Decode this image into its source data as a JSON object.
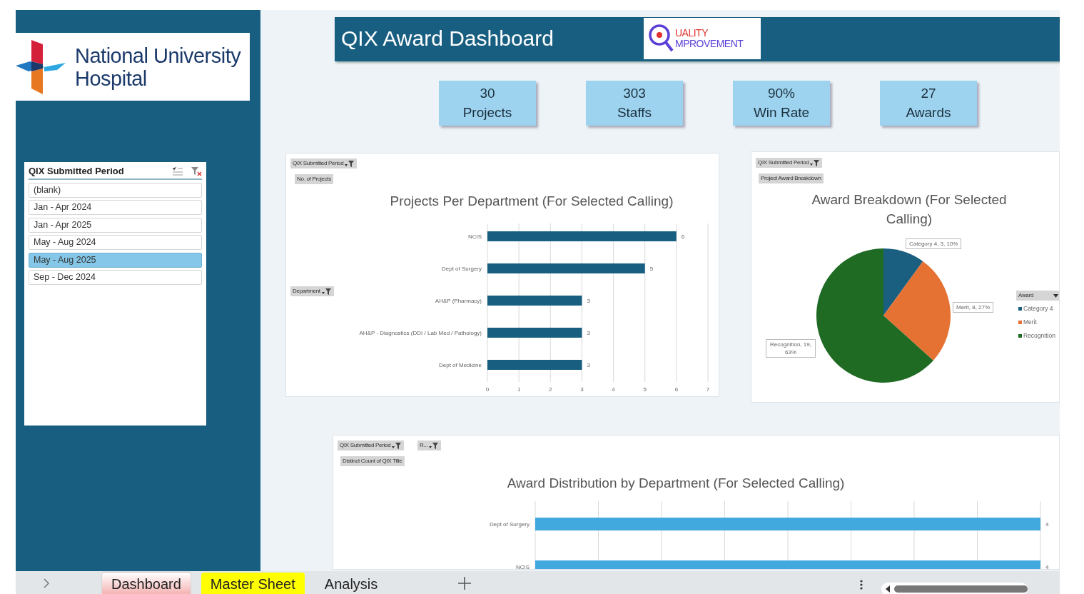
{
  "logo": {
    "line_1": "National University",
    "line_2": "Hospital"
  },
  "slicer": {
    "title": "QIX Submitted Period",
    "items": [
      {
        "label": "(blank)",
        "selected": false
      },
      {
        "label": "Jan - Apr 2024",
        "selected": false
      },
      {
        "label": "Jan - Apr 2025",
        "selected": false
      },
      {
        "label": "May - Aug 2024",
        "selected": false
      },
      {
        "label": "May - Aug 2025",
        "selected": true
      },
      {
        "label": "Sep - Dec 2024",
        "selected": false
      }
    ]
  },
  "banner": {
    "title": "QIX Award Dashboard",
    "badge": {
      "line_1": "UALITY",
      "line_2": "MPROVEMENT"
    }
  },
  "kpis": [
    {
      "value": "30",
      "label": "Projects"
    },
    {
      "value": "303",
      "label": "Staffs"
    },
    {
      "value": "90%",
      "label": "Win Rate"
    },
    {
      "value": "27",
      "label": "Awards"
    }
  ],
  "charts": [
    {
      "field_buttons": [
        {
          "label": "QIX Submitted Period",
          "kind": "filter"
        },
        {
          "label": "No. of Projects",
          "kind": "value"
        },
        {
          "label": "Department",
          "kind": "filter"
        }
      ],
      "chart_data": {
        "type": "bar",
        "orientation": "horizontal",
        "title": "Projects Per Department (For Selected Calling)",
        "categories": [
          "NCIS",
          "Dept of Surgery",
          "AH&P (Pharmacy)",
          "AH&P - Diagnostics (DDI / Lab Med / Pathology)",
          "Dept of Medicine"
        ],
        "values": [
          6,
          5,
          3,
          3,
          3
        ],
        "xticks": [
          0,
          1,
          2,
          3,
          4,
          5,
          6,
          7
        ],
        "xlim": [
          0,
          7
        ],
        "grid": true,
        "data_labels": true
      }
    },
    {
      "field_buttons": [
        {
          "label": "QIX Submitted Period",
          "kind": "filter"
        },
        {
          "label": "Project Award Breakdown",
          "kind": "value"
        }
      ],
      "chart_data": {
        "type": "pie",
        "title": "Award Breakdown (For Selected Calling)",
        "categories": [
          "Category 4",
          "Merit",
          "Recognition"
        ],
        "values": [
          3,
          8,
          19
        ],
        "colors": [
          "#1a5e80",
          "#e57232",
          "#1f6b24"
        ],
        "legend": {
          "title": "Award"
        },
        "value_labels": [
          "Category 4, 3, 10%",
          "Merit, 8, 27%",
          "Recognition, 19, 63%"
        ]
      }
    },
    {
      "field_buttons": [
        {
          "label": "QIX Submitted Period",
          "kind": "filter"
        },
        {
          "label": "R...",
          "kind": "filter"
        },
        {
          "label": "Distinct Count of QIX Title",
          "kind": "value"
        }
      ],
      "chart_data": {
        "type": "bar",
        "orientation": "horizontal",
        "title": "Award Distribution by Department (For Selected Calling)",
        "categories": [
          "Dept of Surgery",
          "NCIS"
        ],
        "values": [
          4,
          4
        ],
        "grid": true,
        "data_labels": true
      }
    }
  ],
  "sheet_tabs": [
    {
      "label": "Dashboard",
      "selected": true
    },
    {
      "label": "Master Sheet",
      "selected": false,
      "color": "#ffff00"
    },
    {
      "label": "Analysis",
      "selected": false
    }
  ]
}
